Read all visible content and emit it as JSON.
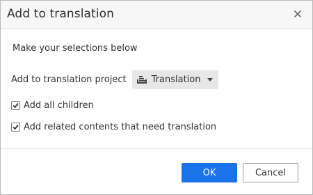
{
  "dialog": {
    "title": "Add to translation",
    "close_icon": "close-icon"
  },
  "body": {
    "subtitle": "Make your selections below",
    "project_label": "Add to translation project",
    "project_dropdown": {
      "icon": "translation-project-icon",
      "selected": "Translation"
    },
    "options": [
      {
        "label": "Add all children",
        "checked": true
      },
      {
        "label": "Add related contents that need translation",
        "checked": true
      }
    ]
  },
  "footer": {
    "ok_label": "OK",
    "cancel_label": "Cancel"
  },
  "colors": {
    "primary": "#1a73e8",
    "header_bg": "#f7f7f7",
    "dropdown_bg": "#e7e7e7"
  }
}
